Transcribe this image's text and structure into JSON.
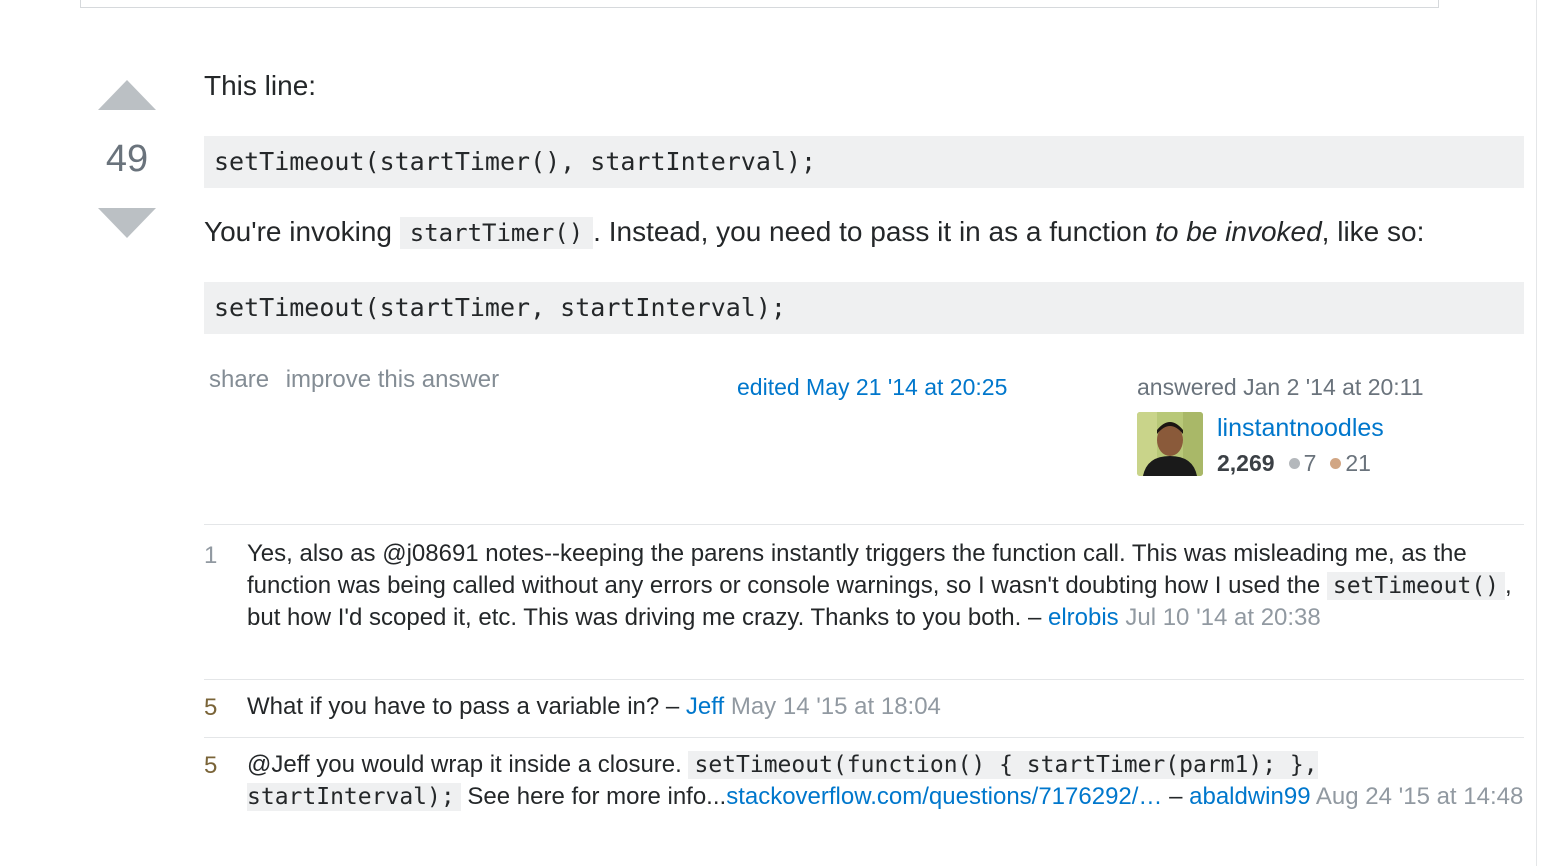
{
  "vote": {
    "count": "49"
  },
  "answer": {
    "intro": "This line:",
    "code1": "setTimeout(startTimer(), startInterval);",
    "p2_before": "You're invoking ",
    "p2_code": "startTimer()",
    "p2_mid": ". Instead, you need to pass it in as a function ",
    "p2_em": "to be invoked",
    "p2_after": ", like so:",
    "code2": "setTimeout(startTimer, startInterval);"
  },
  "post_menu": {
    "share": "share",
    "improve": "improve this answer"
  },
  "edited": "edited May 21 '14 at 20:25",
  "answered": "answered Jan 2 '14 at 20:11",
  "user": {
    "name": "linstantnoodles",
    "reputation": "2,269",
    "silver": "7",
    "bronze": "21",
    "silver_color": "#b4b8bc",
    "bronze_color": "#d1a684"
  },
  "comments": [
    {
      "score": "1",
      "text_a": "Yes, also as @j08691 notes--keeping the parens instantly triggers the function call. This was misleading me, as the function was being called without any errors or console warnings, so I wasn't doubting how I used the ",
      "code": "setTimeout()",
      "text_b": ", but how I'd scoped it, etc. This was driving me crazy. Thanks to you both. – ",
      "user": "elrobis",
      "date": " Jul 10 '14 at 20:38"
    },
    {
      "score": "5",
      "text_a": "What if you have to pass a variable in? – ",
      "user": "Jeff",
      "date": " May 14 '15 at 18:04"
    },
    {
      "score": "5",
      "text_a": "@Jeff you would wrap it inside a closure. ",
      "code": "setTimeout(function() { startTimer(parm1); }, startInterval);",
      "text_b": " See here for more info...",
      "link": "stackoverflow.com/questions/7176292/…",
      "text_c": " – ",
      "user": "abaldwin99",
      "date": " Aug 24 '15 at 14:48"
    }
  ]
}
